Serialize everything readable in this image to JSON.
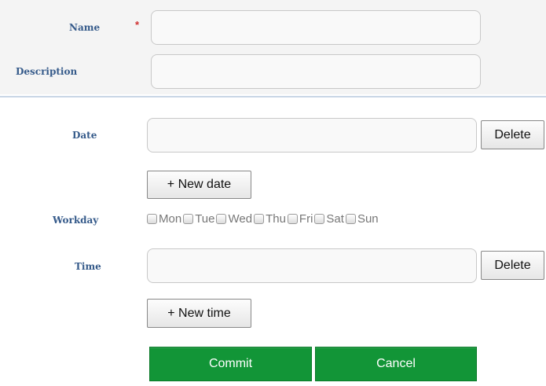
{
  "form": {
    "name": {
      "label": "Name",
      "required_marker": "*",
      "value": ""
    },
    "description": {
      "label": "Description",
      "value": ""
    },
    "date": {
      "label": "Date",
      "value": "",
      "delete_label": "Delete",
      "new_label": "+ New date"
    },
    "workday": {
      "label": "Workday",
      "days": [
        {
          "label": "Mon",
          "checked": false
        },
        {
          "label": "Tue",
          "checked": false
        },
        {
          "label": "Wed",
          "checked": false
        },
        {
          "label": "Thu",
          "checked": false
        },
        {
          "label": "Fri",
          "checked": false
        },
        {
          "label": "Sat",
          "checked": false
        },
        {
          "label": "Sun",
          "checked": false
        }
      ]
    },
    "time": {
      "label": "Time",
      "value": "",
      "delete_label": "Delete",
      "new_label": "+ New time"
    }
  },
  "actions": {
    "commit_label": "Commit",
    "cancel_label": "Cancel"
  },
  "colors": {
    "label": "#355a8a",
    "required": "#d03030",
    "action_green": "#129537"
  }
}
